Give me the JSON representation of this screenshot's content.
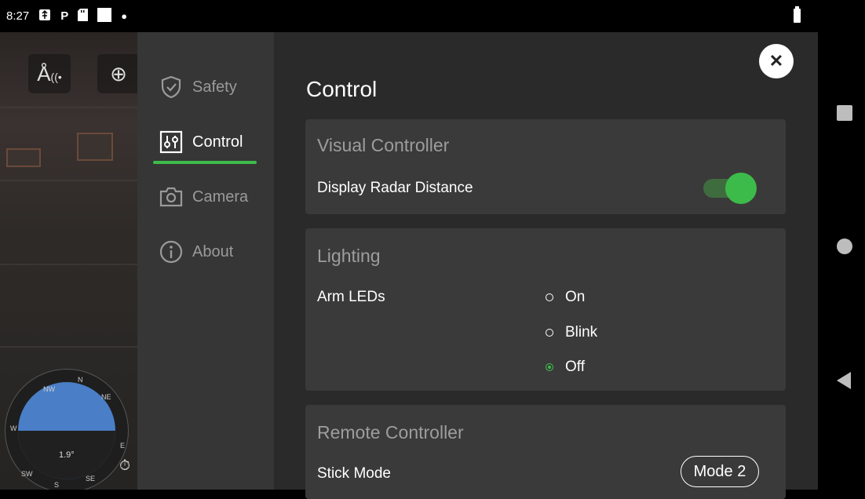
{
  "status_bar": {
    "time": "8:27",
    "icons": [
      "usb-icon",
      "parking-icon",
      "sd-card-icon",
      "square-icon",
      "dot-icon"
    ]
  },
  "camera": {
    "attitude_value": "1.9°",
    "compass": [
      "NW",
      "N",
      "NE",
      "W",
      "E",
      "SW",
      "S",
      "SE"
    ]
  },
  "sidebar": {
    "items": [
      {
        "label": "Safety",
        "icon": "shield-check-icon",
        "active": false
      },
      {
        "label": "Control",
        "icon": "sliders-icon",
        "active": true
      },
      {
        "label": "Camera",
        "icon": "camera-icon",
        "active": false
      },
      {
        "label": "About",
        "icon": "info-icon",
        "active": false
      }
    ]
  },
  "main": {
    "title": "Control",
    "visual_controller": {
      "title": "Visual Controller",
      "radar_label": "Display Radar Distance",
      "radar_enabled": true
    },
    "lighting": {
      "title": "Lighting",
      "arm_leds_label": "Arm LEDs",
      "options": [
        {
          "label": "On",
          "selected": false
        },
        {
          "label": "Blink",
          "selected": false
        },
        {
          "label": "Off",
          "selected": true
        }
      ]
    },
    "remote_controller": {
      "title": "Remote Controller",
      "stick_mode_label": "Stick Mode",
      "stick_mode_value": "Mode 2"
    }
  },
  "colors": {
    "accent": "#3dbb4a",
    "sidebar_bg": "#363636",
    "main_bg": "#2a2a2a",
    "card_bg": "#3a3a3a"
  }
}
